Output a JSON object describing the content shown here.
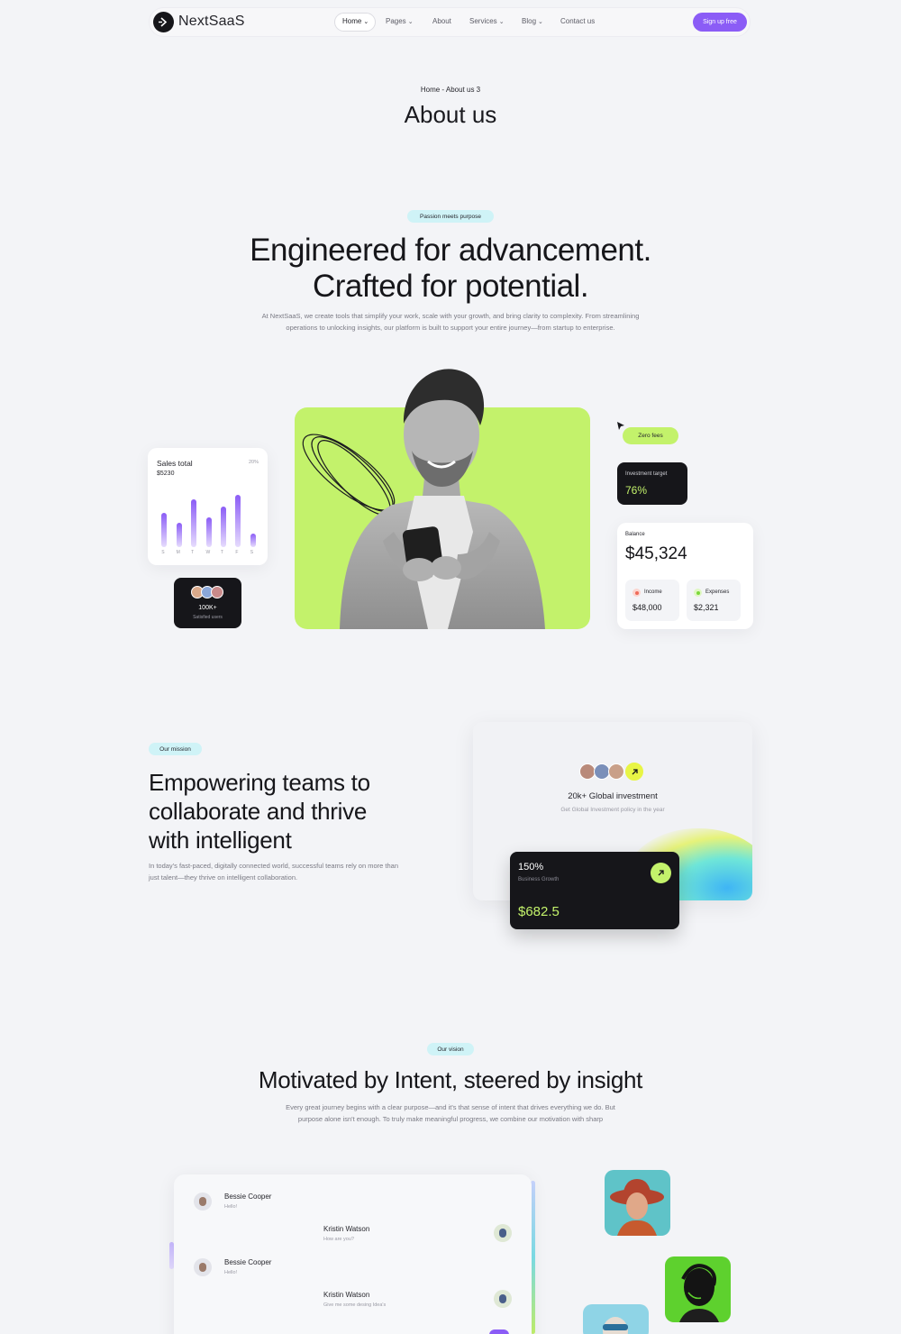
{
  "nav": {
    "brand": "NextSaaS",
    "items": [
      {
        "label": "Home",
        "has_menu": true
      },
      {
        "label": "Pages",
        "has_menu": true
      },
      {
        "label": "About",
        "has_menu": false
      },
      {
        "label": "Services",
        "has_menu": true
      },
      {
        "label": "Blog",
        "has_menu": true
      },
      {
        "label": "Contact us",
        "has_menu": false
      }
    ],
    "cta": "Sign up free"
  },
  "header": {
    "breadcrumb": "Home - About us 3",
    "title": "About us"
  },
  "intro": {
    "badge": "Passion meets purpose",
    "heading_line1": "Engineered for advancement.",
    "heading_line2": "Crafted for potential.",
    "body_line1": "At NextSaaS, we create tools that simplify your work, scale with your growth, and bring clarity to complexity. From streamlining",
    "body_line2": "operations to unlocking insights, our platform is built to support your entire journey—from startup to enterprise."
  },
  "sales_card": {
    "title": "Sales total",
    "amount": "$5230",
    "percent": "20%",
    "days": [
      "S",
      "M",
      "T",
      "W",
      "T",
      "F",
      "S"
    ],
    "values": [
      38,
      27,
      53,
      33,
      45,
      58,
      15
    ]
  },
  "users_card": {
    "count": "100K+",
    "label": "Satisfied users"
  },
  "zero_fees": "Zero fees",
  "investment_card": {
    "label": "Investment target",
    "value": "76%"
  },
  "balance_card": {
    "label": "Balance",
    "amount": "$45,324",
    "income_label": "Income",
    "income": "$48,000",
    "expenses_label": "Expenses",
    "expenses": "$2,321"
  },
  "mission": {
    "badge": "Our mission",
    "heading_line1": "Empowering teams to",
    "heading_line2": "collaborate and thrive",
    "heading_line3": "with intelligent",
    "body_line1": "In today's fast-paced, digitally connected world, successful teams rely on more than",
    "body_line2": "just talent—they thrive on intelligent collaboration."
  },
  "investment_panel": {
    "title": "20k+ Global investment",
    "subtitle": "Get Global Investment policy in the year"
  },
  "growth_card": {
    "percent": "150%",
    "label": "Business Growth",
    "value": "$682.5"
  },
  "vision": {
    "badge": "Our vision",
    "heading": "Motivated by Intent, steered by insight",
    "body_line1": "Every great journey begins with a clear purpose—and it's that sense of intent that drives everything we do. But",
    "body_line2": "purpose alone isn't enough. To truly make meaningful progress, we combine our motivation with sharp"
  },
  "chat": [
    {
      "name": "Bessie Cooper",
      "message": "Hello!"
    },
    {
      "name": "Kristin Watson",
      "message": "How are you?"
    },
    {
      "name": "Bessie Cooper",
      "message": "Hello!"
    },
    {
      "name": "Kristin Watson",
      "message": "Give me some desing Idea's"
    }
  ],
  "colors": {
    "accent": "#8b5cf6",
    "lime": "#c3f26b",
    "cyan_pill": "#cff3f7",
    "dark": "#16161a"
  }
}
